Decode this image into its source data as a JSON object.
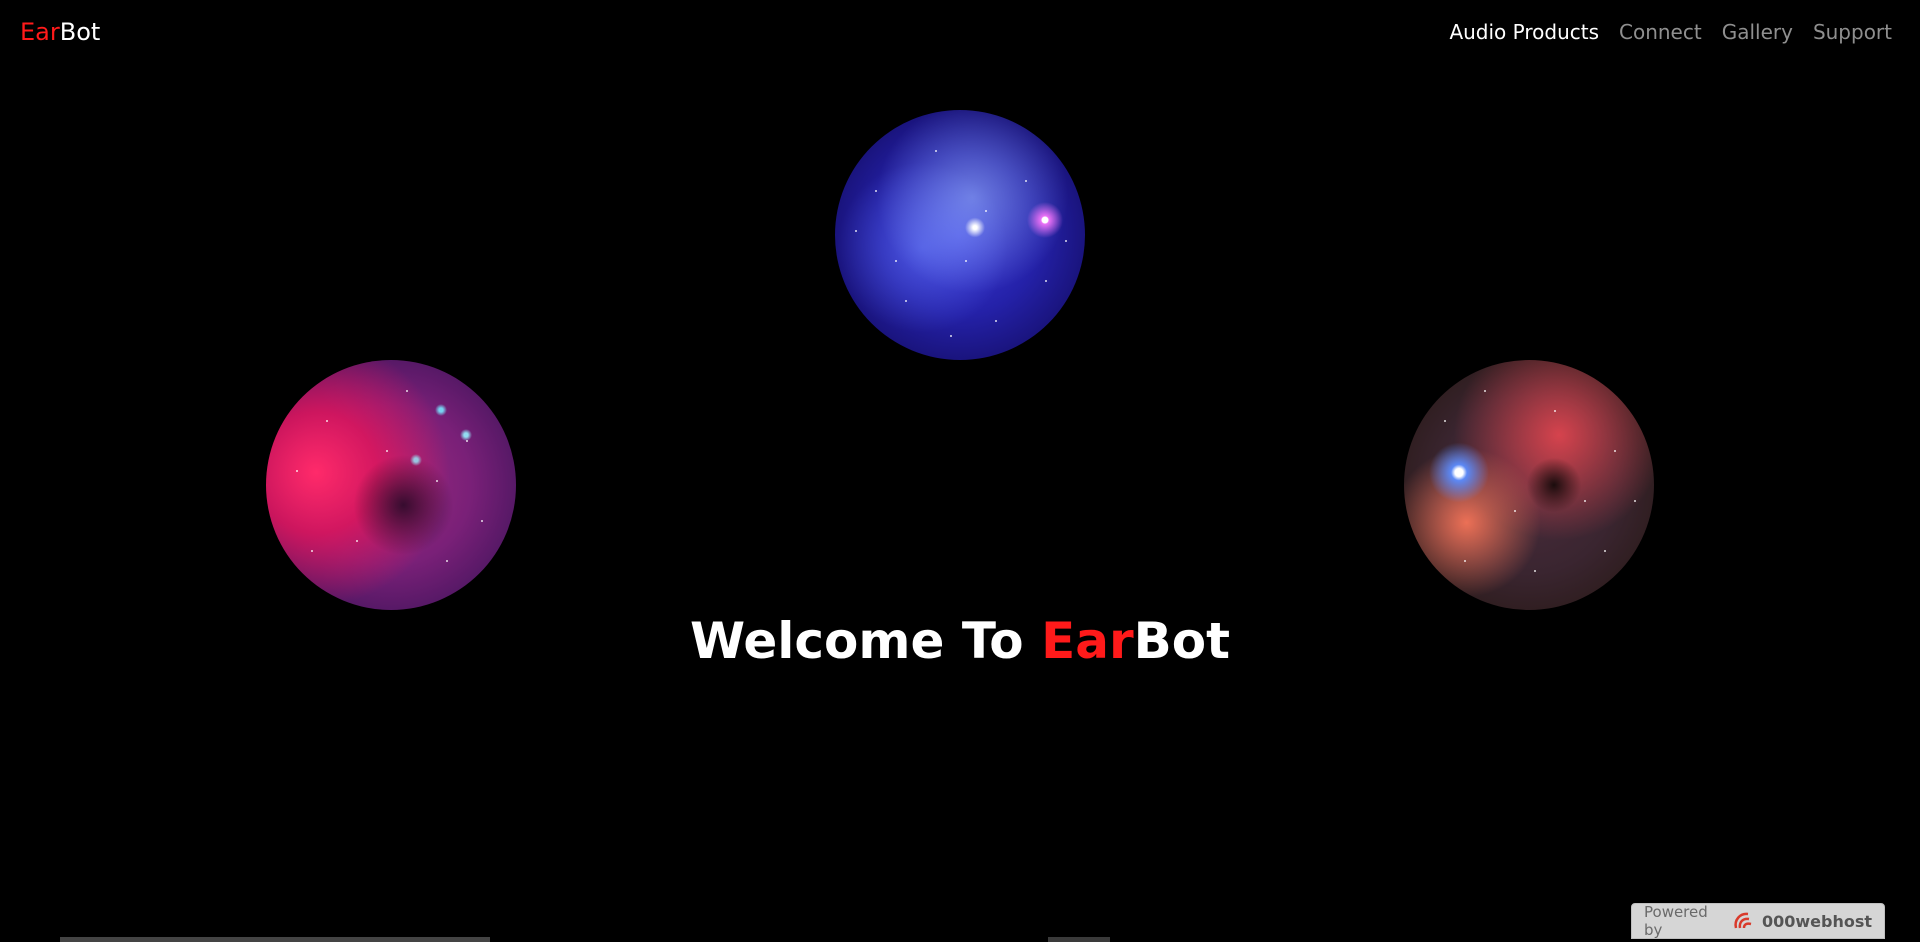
{
  "header": {
    "brand_accent": "Ear",
    "brand_rest": "Bot",
    "nav": [
      {
        "label": "Audio Products",
        "active": true
      },
      {
        "label": "Connect",
        "active": false
      },
      {
        "label": "Gallery",
        "active": false
      },
      {
        "label": "Support",
        "active": false
      }
    ]
  },
  "hero": {
    "headline_prefix": "Welcome To ",
    "headline_accent": "Ear",
    "headline_suffix": "Bot",
    "images": [
      {
        "name": "nebula-blue-image"
      },
      {
        "name": "nebula-pink-image"
      },
      {
        "name": "nebula-horsehead-image"
      }
    ]
  },
  "badge": {
    "powered_by": "Powered by",
    "host_name": "000webhost"
  },
  "colors": {
    "background": "#000000",
    "accent": "#ff1a1a",
    "nav_active": "#ffffff",
    "nav_inactive": "#8f8f8f"
  }
}
